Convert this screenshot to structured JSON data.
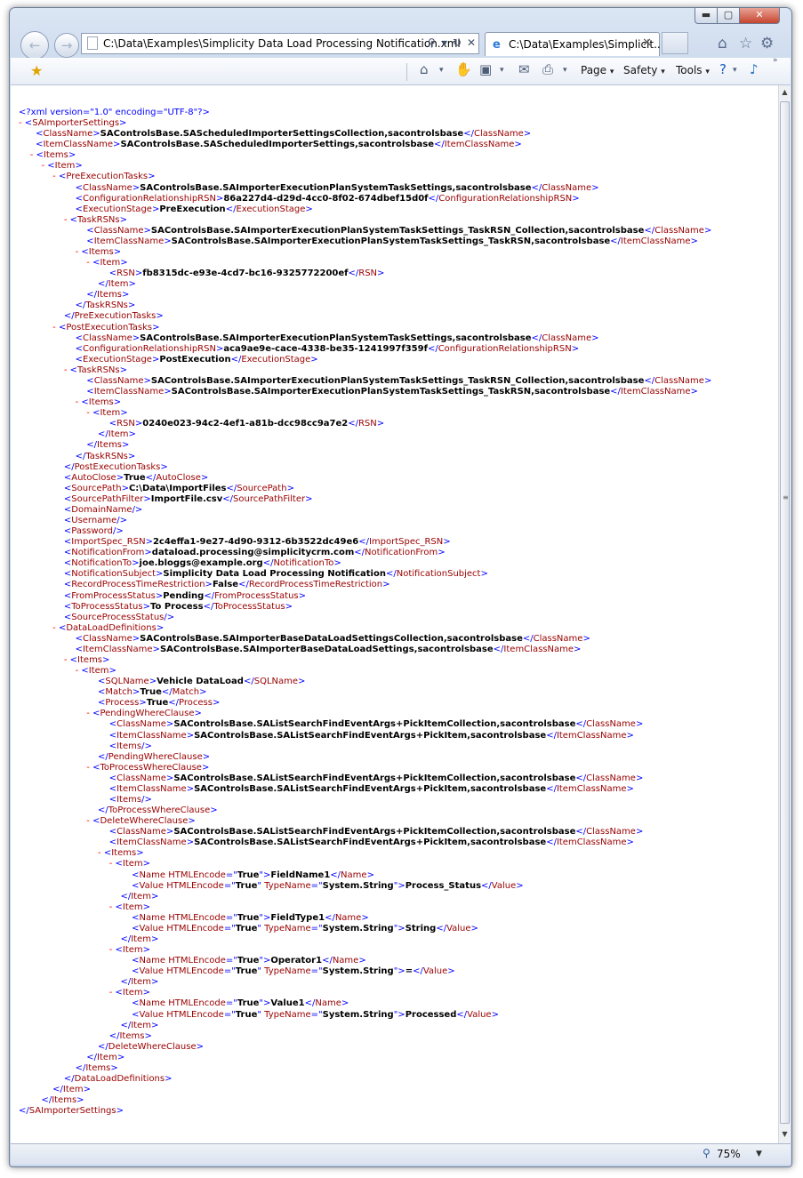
{
  "window": {
    "address_url": "C:\\Data\\Examples\\Simplicity Data Load Processing Notification.xml",
    "tab_title": "C:\\Data\\Examples\\Simplicit...",
    "minimize": "▬",
    "maximize": "▢",
    "close": "✕"
  },
  "command_bar": {
    "page_label": "Page",
    "safety_label": "Safety",
    "tools_label": "Tools",
    "dropdown_glyph": "▾"
  },
  "status_bar": {
    "zoom_level": "75%"
  },
  "xml": {
    "declaration": "<?xml version=\"1.0\" encoding=\"UTF-8\"?>",
    "root": "SAImporterSettings",
    "class_name": "SAControlsBase.SAScheduledImporterSettingsCollection,sacontrolsbase",
    "item_class_name": "SAControlsBase.SAScheduledImporterSettings,sacontrolsbase",
    "pre_execution": {
      "class_name": "SAControlsBase.SAImporterExecutionPlanSystemTaskSettings,sacontrolsbase",
      "configuration_relationship_rsn": "86a227d4-d29d-4cc0-8f02-674dbef15d0f",
      "execution_stage": "PreExecution",
      "task_rsns_class_name": "SAControlsBase.SAImporterExecutionPlanSystemTaskSettings_TaskRSN_Collection,sacontrolsbase",
      "task_rsns_item_class_name": "SAControlsBase.SAImporterExecutionPlanSystemTaskSettings_TaskRSN,sacontrolsbase",
      "rsn": "fb8315dc-e93e-4cd7-bc16-9325772200ef"
    },
    "post_execution": {
      "class_name": "SAControlsBase.SAImporterExecutionPlanSystemTaskSettings,sacontrolsbase",
      "configuration_relationship_rsn": "aca9ae9e-cace-4338-be35-1241997f359f",
      "execution_stage": "PostExecution",
      "task_rsns_class_name": "SAControlsBase.SAImporterExecutionPlanSystemTaskSettings_TaskRSN_Collection,sacontrolsbase",
      "task_rsns_item_class_name": "SAControlsBase.SAImporterExecutionPlanSystemTaskSettings_TaskRSN,sacontrolsbase",
      "rsn": "0240e023-94c2-4ef1-a81b-dcc98cc9a7e2"
    },
    "auto_close": "True",
    "source_path": "C:\\Data\\ImportFiles",
    "source_path_filter": "ImportFile.csv",
    "import_spec_rsn": "2c4effa1-9e27-4d90-9312-6b3522dc49e6",
    "notification_from": "dataload.processing@simplicitycrm.com",
    "notification_to": "joe.bloggs@example.org",
    "notification_subject": "Simplicity Data Load Processing Notification",
    "record_process_time_restriction": "False",
    "from_process_status": "Pending",
    "to_process_status": "To Process",
    "data_load_definitions": {
      "class_name": "SAControlsBase.SAImporterBaseDataLoadSettingsCollection,sacontrolsbase",
      "item_class_name": "SAControlsBase.SAImporterBaseDataLoadSettings,sacontrolsbase",
      "sql_name": "Vehicle DataLoad",
      "match": "True",
      "process": "True",
      "where_class_name": "SAControlsBase.SAListSearchFindEventArgs+PickItemCollection,sacontrolsbase",
      "where_item_class_name": "SAControlsBase.SAListSearchFindEventArgs+PickItem,sacontrolsbase",
      "delete_items": [
        {
          "name": "FieldName1",
          "value": "Process_Status"
        },
        {
          "name": "FieldType1",
          "value": "String"
        },
        {
          "name": "Operator1",
          "value": "="
        },
        {
          "name": "Value1",
          "value": "Processed"
        }
      ],
      "html_encode": "True",
      "type_name": "System.String"
    }
  }
}
